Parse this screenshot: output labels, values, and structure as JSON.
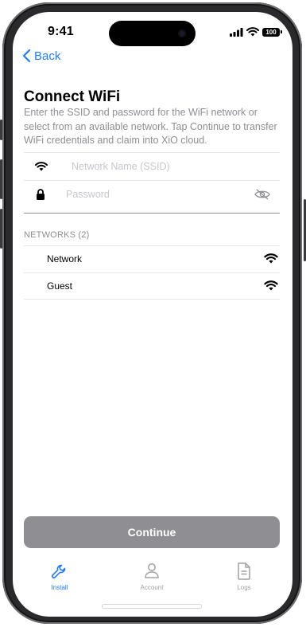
{
  "status_bar": {
    "time": "9:41",
    "battery": "100"
  },
  "nav": {
    "back_label": "Back"
  },
  "page": {
    "title": "Connect WiFi",
    "description": "Enter the SSID and password for the WiFi network or select from an available network.  Tap Continue to transfer WiFi credentials and claim into XiO cloud."
  },
  "form": {
    "ssid": {
      "value": "",
      "placeholder": "Network Name (SSID)"
    },
    "password": {
      "value": "",
      "placeholder": "Password"
    }
  },
  "networks": {
    "header": "NETWORKS (2)",
    "items": [
      {
        "name": "Network"
      },
      {
        "name": "Guest"
      }
    ]
  },
  "actions": {
    "continue_label": "Continue"
  },
  "tabbar": {
    "tabs": [
      {
        "label": "Install",
        "icon": "wrench-icon",
        "active": true
      },
      {
        "label": "Account",
        "icon": "person-icon",
        "active": false
      },
      {
        "label": "Logs",
        "icon": "document-icon",
        "active": false
      }
    ]
  },
  "colors": {
    "accent": "#1f7bff",
    "secondary_text": "#8e8e93",
    "button_disabled": "#8e8e93",
    "inactive_tab": "#a0a0a5"
  }
}
